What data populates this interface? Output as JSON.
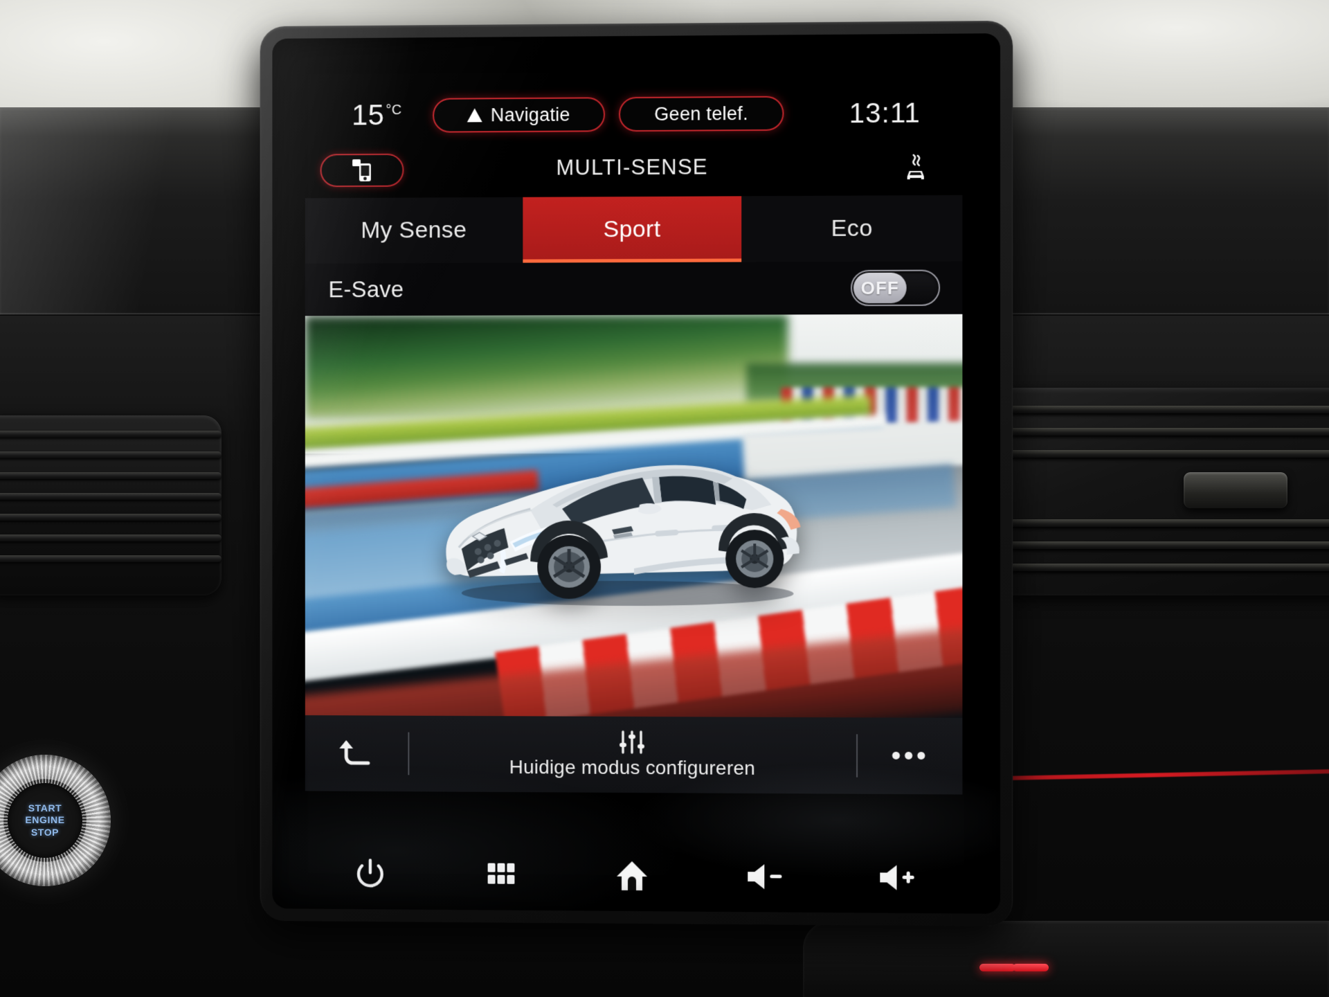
{
  "vehicle": {
    "start_button": {
      "line1": "START",
      "line2": "ENGINE",
      "line3": "STOP"
    }
  },
  "screen": {
    "status_bar": {
      "temperature": "15",
      "temperature_unit": "°C",
      "navigation_pill": "Navigatie",
      "phone_pill": "Geen telef.",
      "clock": "13:11",
      "nav_icon": "navigation-arrow-icon"
    },
    "title_bar": {
      "title": "MULTI-SENSE",
      "left_icon": "smartphone-connect-icon",
      "right_icon": "car-emission-icon"
    },
    "tabs": [
      {
        "label": "My Sense",
        "active": false
      },
      {
        "label": "Sport",
        "active": true
      },
      {
        "label": "Eco",
        "active": false
      }
    ],
    "settings_row": {
      "label": "E-Save",
      "toggle_state": "OFF"
    },
    "hero": {
      "alt": "White Renault Arkana SUV driving on a race circuit with red and white kerbs"
    },
    "action_bar": {
      "back_icon": "back-arrow-icon",
      "configure_icon": "sliders-icon",
      "configure_label": "Huidige modus configureren",
      "more_label": "•••"
    },
    "hardware_keys": [
      {
        "name": "power-icon"
      },
      {
        "name": "apps-grid-icon"
      },
      {
        "name": "home-icon"
      },
      {
        "name": "volume-down-icon"
      },
      {
        "name": "volume-up-icon"
      }
    ],
    "colors": {
      "accent_red": "#c2211f",
      "pill_border": "#c3262c",
      "active_tab_underline": "#ff6a3d",
      "text_primary": "#f0f0f0",
      "screen_background": "#000000",
      "start_button_text": "#8fb8e8"
    }
  }
}
